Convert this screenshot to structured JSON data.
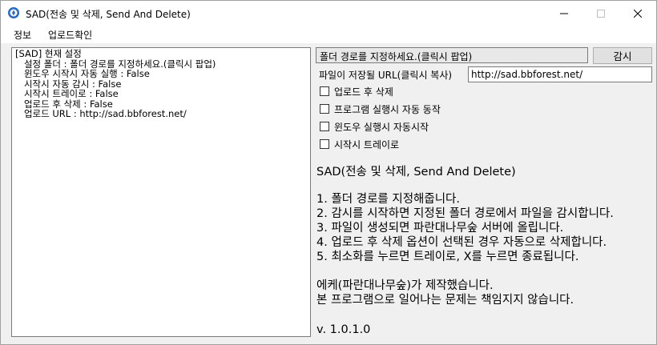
{
  "window": {
    "title": "SAD(전송 및 삭제, Send And Delete)",
    "minimize_glyph": "—",
    "maximize_glyph": "☐",
    "close_glyph": "✕"
  },
  "menu": {
    "items": [
      "정보",
      "업로드확인"
    ]
  },
  "log": {
    "lines": [
      "[SAD] 현재 설정",
      "   설정 폴더 : 폴더 경로를 지정하세요.(클릭시 팝업)",
      "   윈도우 시작시 자동 실행 : False",
      "   시작시 자동 감시 : False",
      "   시작시 트레이로 : False",
      "   업로드 후 삭제 : False",
      "   업로드 URL : http://sad.bbforest.net/"
    ]
  },
  "path_field": {
    "text": "폴더 경로를 지정하세요.(클릭시 팝업)"
  },
  "monitor_button": {
    "label": "감시"
  },
  "url": {
    "label": "파일이 저장될 URL(클릭시 복사)",
    "value": "http://sad.bbforest.net/"
  },
  "options": [
    {
      "label": "업로드 후 삭제",
      "checked": false
    },
    {
      "label": "프로그램 실행시 자동 동작",
      "checked": false
    },
    {
      "label": "윈도우 실행시 자동시작",
      "checked": false
    },
    {
      "label": "시작시 트레이로",
      "checked": false
    }
  ],
  "description": {
    "title": "SAD(전송 및 삭제, Send And Delete)",
    "steps": [
      "1. 폴더 경로를 지정해줍니다.",
      "2. 감시를 시작하면 지정된 폴더 경로에서 파일을 감시합니다.",
      "3. 파일이 생성되면 파란대나무숲 서버에 올립니다.",
      "4. 업로드 후 삭제 옵션이 선택된 경우 자동으로 삭제합니다.",
      "5. 최소화를 누르면 트레이로, X를 누르면 종료됩니다."
    ],
    "credit_1": "에케(파란대나무숲)가 제작했습니다.",
    "credit_2": "본 프로그램으로 일어나는 문제는 책임지지 않습니다.",
    "version": "v. 1.0.1.0"
  },
  "colors": {
    "app_icon": "#2b6cc4"
  }
}
